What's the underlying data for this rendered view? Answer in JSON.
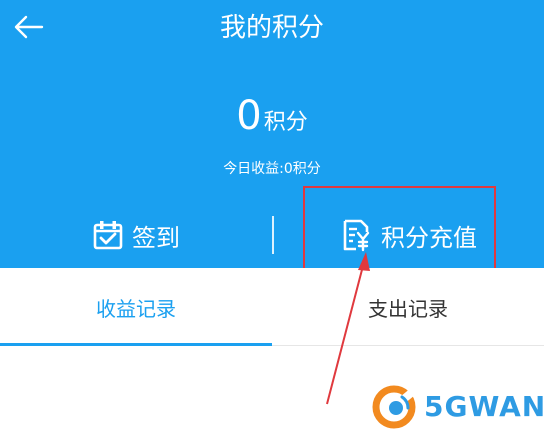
{
  "header": {
    "title": "我的积分",
    "points_value": "0",
    "points_unit": "积分",
    "today_earnings": "今日收益:0积分"
  },
  "actions": {
    "checkin_label": "签到",
    "recharge_label": "积分充值"
  },
  "tabs": [
    {
      "label": "收益记录",
      "active": true
    },
    {
      "label": "支出记录",
      "active": false
    }
  ],
  "watermark": {
    "text": "5GWAN"
  },
  "colors": {
    "primary": "#1aa0f0",
    "annotation": "#e0393e",
    "watermark_orange": "#f28a1f",
    "watermark_blue": "#2e9be3"
  }
}
